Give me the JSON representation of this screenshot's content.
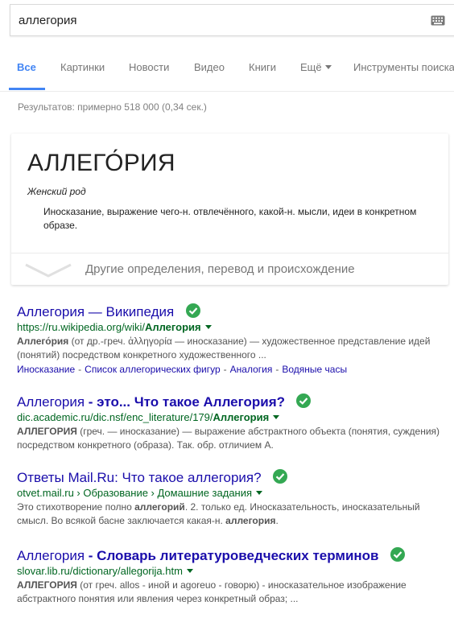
{
  "search": {
    "query": "аллегория"
  },
  "tabs": [
    {
      "label": "Все",
      "active": true
    },
    {
      "label": "Картинки"
    },
    {
      "label": "Новости"
    },
    {
      "label": "Видео"
    },
    {
      "label": "Книги"
    },
    {
      "label": "Ещё"
    },
    {
      "label": "Инструменты поиска"
    }
  ],
  "results_count": "Результатов: примерно 518 000 (0,34 сек.)",
  "dictionary": {
    "word": "АЛЛЕГО́РИЯ",
    "part_of_speech": "Женский род",
    "definition": "Иносказание, выражение чего-н. отвлечённого, какой-н. мысли, идеи в конкретном образе.",
    "more_label": "Другие определения, перевод и происхождение"
  },
  "results": [
    {
      "title": "Аллегория — Википедия",
      "url_prefix": "https://ru.wikipedia.org/wiki/",
      "url_bold": "Аллегория",
      "snippet_bold": "Аллего́рия",
      "snippet_rest": " (от др.-греч. ἀλληγορία — иносказание) — художественное представление идей (понятий) посредством конкретного художественного ...",
      "sitelinks": [
        "Иносказание",
        "Список аллегорических фигур",
        "Аналогия",
        "Водяные часы"
      ]
    },
    {
      "title_plain": "Аллегория",
      "title_bold": " - это... Что такое Аллегория?",
      "url_prefix": "dic.academic.ru/dic.nsf/enc_literature/179/",
      "url_bold": "Аллегория",
      "snippet_bold": "АЛЛЕГОРИЯ",
      "snippet_rest": " (греч. — иносказание) — выражение абстрактного объекта (понятия, суждения) посредством конкретного (образа). Так. обр. отличием А."
    },
    {
      "title": "Ответы Mail.Ru: Что такое аллегория?",
      "url": "otvet.mail.ru › Образование › Домашние задания",
      "snippet_a": "Это стихотворение полно ",
      "snippet_b1": "аллегорий",
      "snippet_c": ". 2. только ед. Иносказательность, иносказательный смысл. Во всякой басне заключается какая-н. ",
      "snippet_b2": "аллегория",
      "snippet_d": "."
    },
    {
      "title_plain": "Аллегория",
      "title_bold": " - Словарь литературоведческих терминов",
      "url": "slovar.lib.ru/dictionary/allegorija.htm",
      "snippet_bold": "АЛЛЕГОРИЯ",
      "snippet_rest": " (от греч. allos - иной и agoreuo - говорю) - иносказательное изображение абстрактного понятия или явления через конкретный образ; ..."
    }
  ],
  "colors": {
    "link": "#1a0dab",
    "url": "#006621",
    "accent": "#4285f4",
    "verified": "#34a853"
  }
}
